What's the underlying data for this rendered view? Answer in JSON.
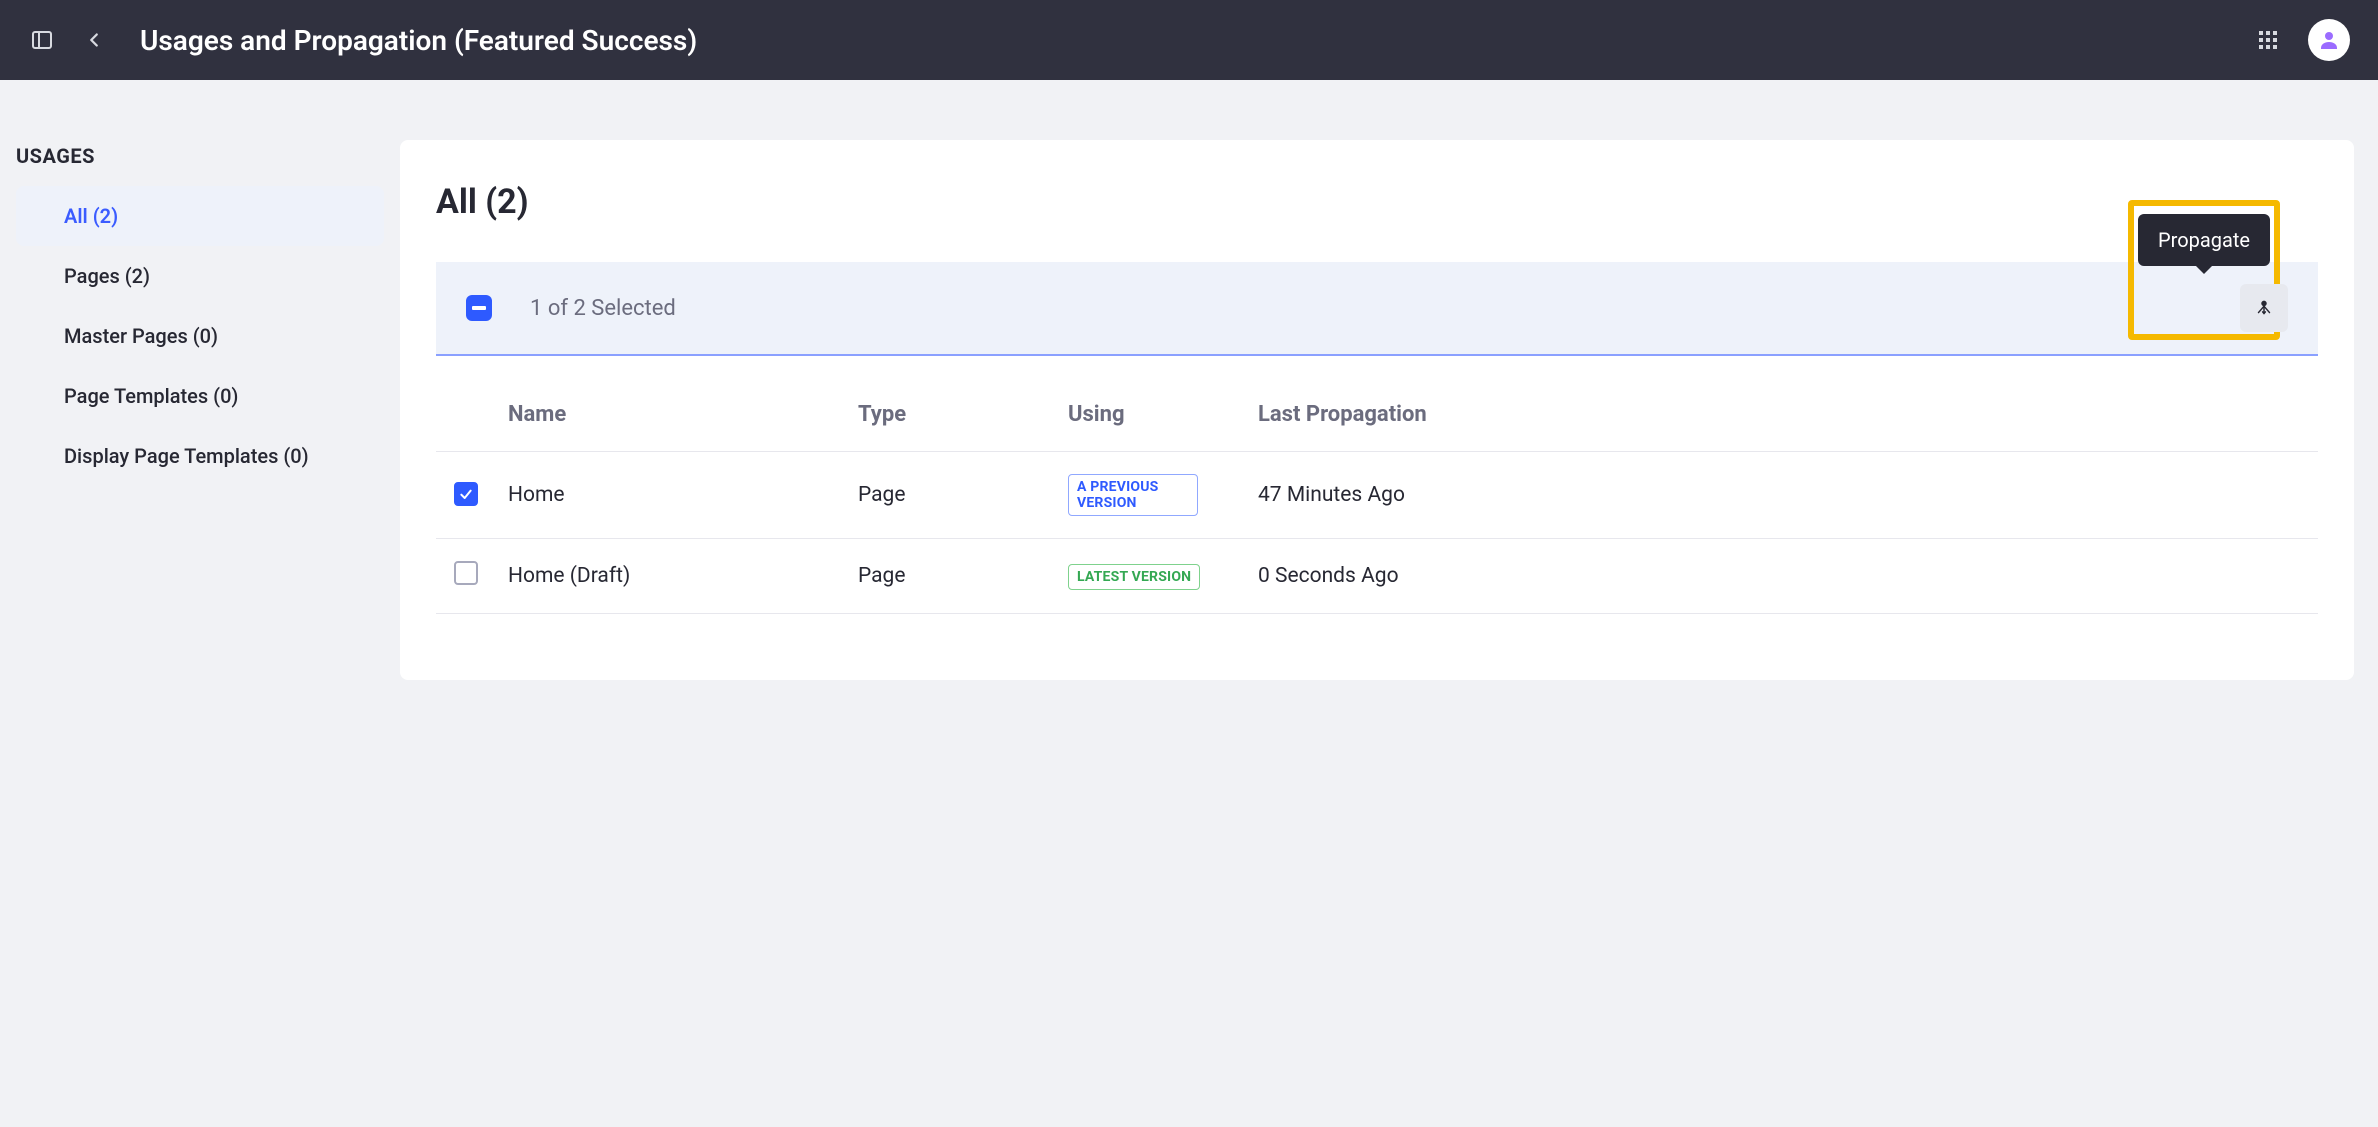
{
  "header": {
    "title": "Usages and Propagation (Featured Success)"
  },
  "sidebar": {
    "heading": "USAGES",
    "items": [
      {
        "label": "All (2)",
        "active": true
      },
      {
        "label": "Pages (2)",
        "active": false
      },
      {
        "label": "Master Pages (0)",
        "active": false
      },
      {
        "label": "Page Templates (0)",
        "active": false
      },
      {
        "label": "Display Page Templates (0)",
        "active": false
      }
    ]
  },
  "main": {
    "title": "All (2)",
    "selection_text": "1 of 2 Selected",
    "tooltip": "Propagate",
    "columns": {
      "name": "Name",
      "type": "Type",
      "using": "Using",
      "last": "Last Propagation"
    },
    "rows": [
      {
        "checked": true,
        "name": "Home",
        "type": "Page",
        "using_badge": "A PREVIOUS VERSION",
        "using_variant": "prev",
        "last": "47 Minutes Ago"
      },
      {
        "checked": false,
        "name": "Home (Draft)",
        "type": "Page",
        "using_badge": "LATEST VERSION",
        "using_variant": "latest",
        "last": "0 Seconds Ago"
      }
    ]
  }
}
